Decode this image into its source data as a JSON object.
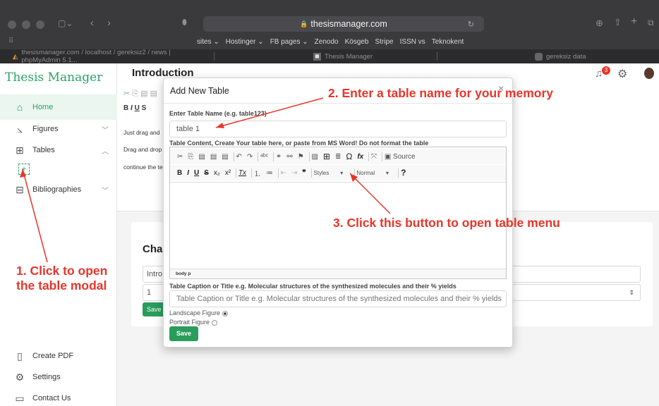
{
  "browser": {
    "url": "thesismanager.com",
    "bookmarks": [
      "sites ⌄",
      "Hostinger ⌄",
      "FB pages ⌄",
      "Zenodo",
      "Kösgeb",
      "Stripe",
      "ISSN vs",
      "Teknokent"
    ],
    "tabs": [
      "thesismanager.com / localhost / gereksiz2 / news | phpMyAdmin 5.1...",
      "Thesis Manager",
      "gereksiz data"
    ]
  },
  "app": {
    "brand": "Thesis Manager",
    "nav": [
      {
        "label": "Home"
      },
      {
        "label": "Figures"
      },
      {
        "label": "Tables"
      },
      {
        "label": "Bibliographies"
      }
    ],
    "bottom_nav": [
      {
        "label": "Create PDF"
      },
      {
        "label": "Settings"
      },
      {
        "label": "Contact Us"
      }
    ],
    "page_title": "Introduction",
    "notif_count": "3",
    "editor_lines": [
      "Just drag and",
      "Drag and drop",
      "continue the te"
    ],
    "chapter_heading": "Cha",
    "chapter_input": "Intro",
    "chapter_num": "1",
    "chapter_save": "Save"
  },
  "modal": {
    "title": "Add New Table",
    "name_label": "Enter Table Name (e.g. table123)",
    "name_value": "table 1",
    "content_label": "Table Content, Create Your table here, or paste from MS Word! Do not format the table",
    "toolbar_source": "Source",
    "toolbar_styles": "Styles",
    "toolbar_format": "Normal",
    "statusbar": "body  p",
    "caption_label": "Table Caption or Title e.g. Molecular structures of the synthesized molecules and their % yields",
    "caption_placeholder": "Table Caption or Title e.g. Molecular structures of the synthesized molecules and their % yields",
    "landscape": "Landscape Figure",
    "portrait": "Portrait Figure",
    "save": "Save"
  },
  "annotations": {
    "a1": "1. Click to open",
    "a1b": "the table modal",
    "a2": "2. Enter a table name for your memory",
    "a3": "3. Click this button to open table menu"
  },
  "colors": {
    "brand": "#2aa36a",
    "annotation": "#e8352a",
    "save": "#2a9d5c"
  }
}
